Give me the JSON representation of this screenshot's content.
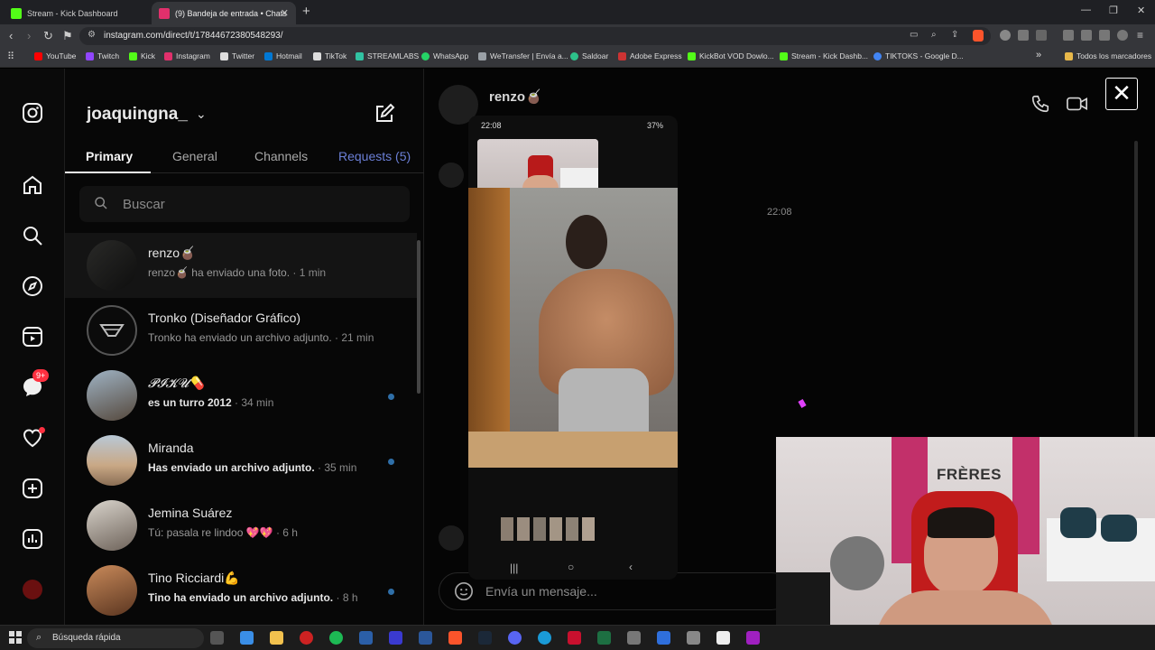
{
  "browser": {
    "tabs": [
      {
        "label": "Stream - Kick Dashboard",
        "favicon_color": "#53fc18"
      },
      {
        "label": "(9) Bandeja de entrada • Chats",
        "favicon_color": "#e1306c"
      }
    ],
    "new_tab": "+",
    "url": "instagram.com/direct/t/17844672380548293/",
    "bookmarks": [
      {
        "label": "YouTube",
        "color": "#ff0000"
      },
      {
        "label": "Twitch",
        "color": "#9146ff"
      },
      {
        "label": "Kick",
        "color": "#53fc18"
      },
      {
        "label": "Instagram",
        "color": "#e1306c"
      },
      {
        "label": "Twitter",
        "color": "#ffffff"
      },
      {
        "label": "Hotmail",
        "color": "#0078d4"
      },
      {
        "label": "TikTok",
        "color": "#ffffff"
      },
      {
        "label": "STREAMLABS",
        "color": "#31c3a2"
      },
      {
        "label": "WhatsApp",
        "color": "#25d366"
      },
      {
        "label": "WeTransfer | Envía a...",
        "color": "#9aa0a6"
      },
      {
        "label": "Saldoar",
        "color": "#2dc28a"
      },
      {
        "label": "Adobe Express",
        "color": "#cc3333"
      },
      {
        "label": "KickBot VOD Dowlo...",
        "color": "#53fc18"
      },
      {
        "label": "Stream - Kick Dashb...",
        "color": "#53fc18"
      },
      {
        "label": "TIKTOKS - Google D...",
        "color": "#4285f4"
      }
    ],
    "bookmarks_more": "»",
    "all_bookmarks": "Todos los marcadores"
  },
  "instagram": {
    "username": "joaquingna_",
    "filter_tabs": [
      "Primary",
      "General",
      "Channels",
      "Requests (5)"
    ],
    "search_placeholder": "Buscar",
    "notif_badge": "9+",
    "conversations": [
      {
        "name": "renzo🧉",
        "preview": "renzo🧉 ha enviado una foto.",
        "time": "· 1 min",
        "unread": false,
        "selected": true
      },
      {
        "name": "Tronko (Diseñador Gráfico)",
        "preview": "Tronko ha enviado un archivo adjunto.",
        "time": "· 21 min",
        "unread": false,
        "selected": false
      },
      {
        "name": "𝓟𝓘𝓚𝓤💊",
        "preview": "es un turro 2012",
        "time": "· 34 min",
        "unread": true,
        "selected": false
      },
      {
        "name": "Miranda",
        "preview": "Has enviado un archivo adjunto.",
        "time": "· 35 min",
        "unread": true,
        "selected": false
      },
      {
        "name": "Jemina Suárez",
        "preview": "Tú: pasala re lindoo 💖💖",
        "time": "· 6 h",
        "unread": false,
        "selected": false
      },
      {
        "name": "Tino Ricciardi💪",
        "preview": "Tino ha enviado un archivo adjunto.",
        "time": "· 8 h",
        "unread": true,
        "selected": false
      }
    ],
    "thread": {
      "peer_name": "renzo🧉",
      "timestamp": "22:08",
      "message_placeholder": "Envía un mensaje..."
    }
  },
  "phone": {
    "time": "22:08",
    "battery": "37%"
  },
  "webcam": {
    "sign_text": "FRÈRES"
  },
  "taskbar": {
    "search_label": "Búsqueda rápida"
  }
}
